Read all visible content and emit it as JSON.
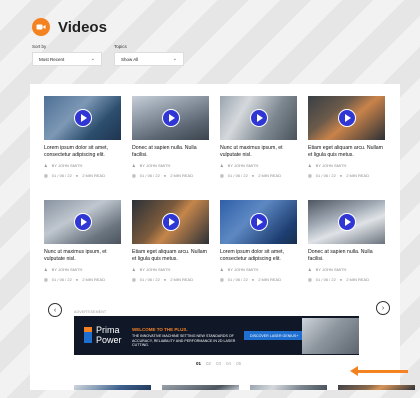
{
  "header": {
    "title": "Videos",
    "icon": "video-camera-icon",
    "accent": "#f58220"
  },
  "filters": {
    "sort": {
      "label": "Sort by",
      "value": "Most Recent"
    },
    "topics": {
      "label": "Topics",
      "value": "Show All"
    }
  },
  "videos_row1": [
    {
      "title": "Lorem ipsum dolor sit amet, consectetur adipiscing elit.",
      "author": "BY JOHN SMITH",
      "date": "01 / 06 / 22",
      "read": "2 MIN READ"
    },
    {
      "title": "Donec at sapien nulla. Nulla facilisi.",
      "author": "BY JOHN SMITH",
      "date": "01 / 06 / 22",
      "read": "2 MIN READ"
    },
    {
      "title": "Nunc ut maximus ipsum, et vulputate nisl.",
      "author": "BY JOHN SMITH",
      "date": "01 / 06 / 22",
      "read": "2 MIN READ"
    },
    {
      "title": "Etiam eget aliquam arcu. Nullam et ligula quis metus.",
      "author": "BY JOHN SMITH",
      "date": "01 / 06 / 22",
      "read": "2 MIN READ"
    }
  ],
  "videos_row2": [
    {
      "title": "Nunc ut maximus ipsum, et vulputate nisl.",
      "author": "BY JOHN SMITH",
      "date": "01 / 06 / 22",
      "read": "2 MIN READ"
    },
    {
      "title": "Etiam eget aliquam arcu. Nullam et ligula quis metus.",
      "author": "BY JOHN SMITH",
      "date": "01 / 06 / 22",
      "read": "2 MIN READ"
    },
    {
      "title": "Lorem ipsum dolor sit amet, consectetur adipiscing elit.",
      "author": "BY JOHN SMITH",
      "date": "01 / 06 / 22",
      "read": "2 MIN READ"
    },
    {
      "title": "Donec at sapien nulla. Nulla facilisi.",
      "author": "BY JOHN SMITH",
      "date": "01 / 06 / 22",
      "read": "2 MIN READ"
    }
  ],
  "ad": {
    "label": "ADVERTISEMENT",
    "brand_line1": "Prima",
    "brand_line2": "Power",
    "headline": "WELCOME TO THE PLUS.",
    "body": "THE INNOVATIVE MACHINE SETTING NEW STANDARDS OF ACCURACY, RELIABILITY AND PERFORMANCE IN 2D LASER CUTTING.",
    "cta": "DISCOVER LASER GENIUS+"
  },
  "pagination": {
    "pages": [
      "01",
      "02",
      "03",
      "04",
      "05"
    ],
    "current": "01"
  }
}
